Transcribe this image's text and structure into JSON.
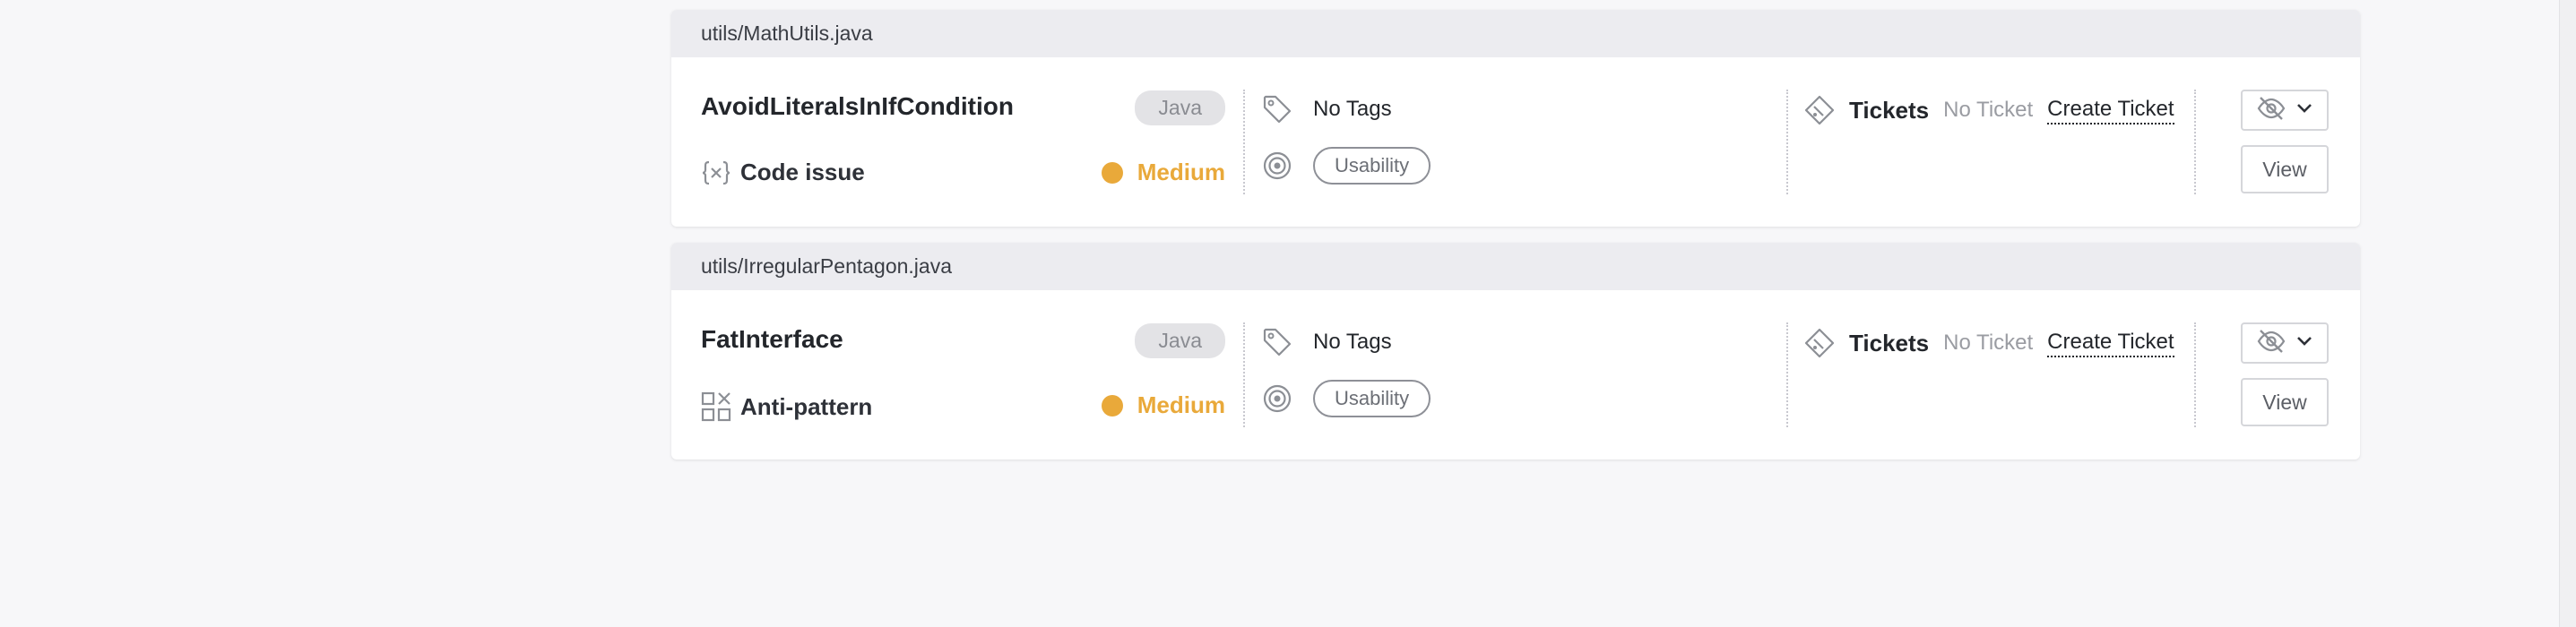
{
  "colors": {
    "medium": "#e9a93a",
    "link": "#23262b"
  },
  "issues": [
    {
      "file": "utils/MathUtils.java",
      "rule": "AvoidLiteralsInIfCondition",
      "language": "Java",
      "category": "Code issue",
      "category_icon": "code-braces-x-icon",
      "severity": "Medium",
      "tags_text": "No Tags",
      "category_tag": "Usability",
      "tickets_label": "Tickets",
      "no_ticket": "No Ticket",
      "create_ticket": "Create Ticket",
      "view_label": "View"
    },
    {
      "file": "utils/IrregularPentagon.java",
      "rule": "FatInterface",
      "language": "Java",
      "category": "Anti-pattern",
      "category_icon": "grid-x-icon",
      "severity": "Medium",
      "tags_text": "No Tags",
      "category_tag": "Usability",
      "tickets_label": "Tickets",
      "no_ticket": "No Ticket",
      "create_ticket": "Create Ticket",
      "view_label": "View"
    }
  ]
}
